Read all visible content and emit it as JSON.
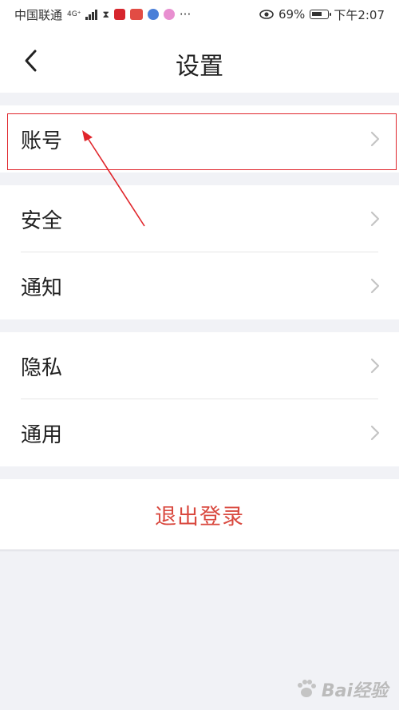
{
  "status_bar": {
    "carrier": "中国联通",
    "network": "4G⁺",
    "battery_percent": "69%",
    "battery_level": 0.69,
    "time": "下午2:07",
    "more": "···"
  },
  "nav": {
    "title": "设置"
  },
  "groups": [
    {
      "items": [
        {
          "label": "账号"
        }
      ]
    },
    {
      "items": [
        {
          "label": "安全"
        },
        {
          "label": "通知"
        }
      ]
    },
    {
      "items": [
        {
          "label": "隐私"
        },
        {
          "label": "通用"
        }
      ]
    }
  ],
  "logout": {
    "label": "退出登录"
  },
  "colors": {
    "highlight": "#e0252b",
    "logout_text": "#d9493f",
    "background": "#f1f2f6"
  },
  "watermark": {
    "text": "Bai经验"
  }
}
